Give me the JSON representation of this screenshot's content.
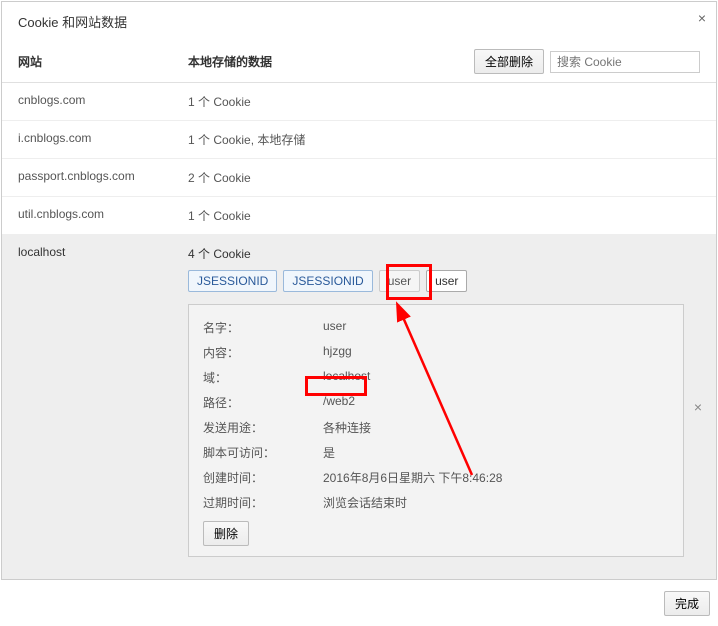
{
  "title": "Cookie 和网站数据",
  "columns": {
    "site": "网站",
    "data": "本地存储的数据"
  },
  "toolbar": {
    "delete_all": "全部删除",
    "search_placeholder": "搜索 Cookie"
  },
  "rows": [
    {
      "site": "cnblogs.com",
      "data": "1 个 Cookie"
    },
    {
      "site": "i.cnblogs.com",
      "data": "1 个 Cookie, 本地存储"
    },
    {
      "site": "passport.cnblogs.com",
      "data": "2 个 Cookie"
    },
    {
      "site": "util.cnblogs.com",
      "data": "1 个 Cookie"
    }
  ],
  "selected": {
    "site": "localhost",
    "data": "4 个 Cookie",
    "chips": [
      "JSESSIONID",
      "JSESSIONID",
      "user",
      "user"
    ]
  },
  "details": {
    "labels": {
      "name": "名字：",
      "content": "内容：",
      "domain": "域：",
      "path": "路径：",
      "send_for": "发送用途：",
      "script": "脚本可访问：",
      "created": "创建时间：",
      "expires": "过期时间："
    },
    "values": {
      "name": "user",
      "content": "hjzgg",
      "domain": "localhost",
      "path": "/web2",
      "send_for": "各种连接",
      "script": "是",
      "created": "2016年8月6日星期六 下午8:46:28",
      "expires": "浏览会话结束时"
    },
    "delete": "删除"
  },
  "footer": {
    "done": "完成"
  }
}
